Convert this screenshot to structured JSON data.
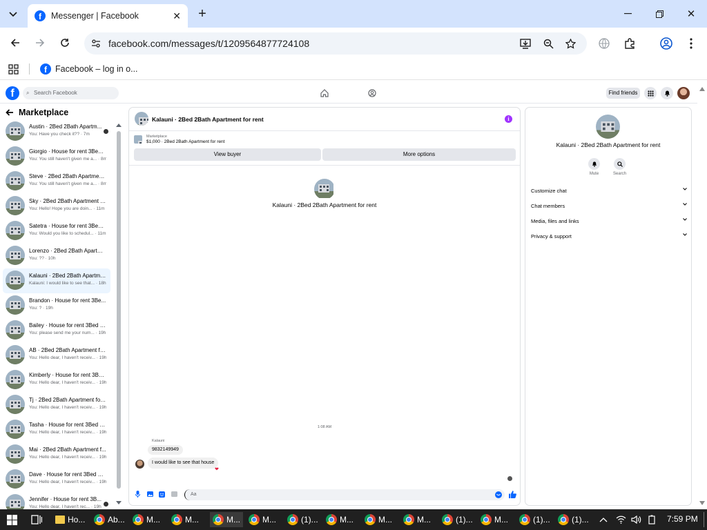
{
  "browser": {
    "tab_title": "Messenger | Facebook",
    "url": "facebook.com/messages/t/1209564877724108",
    "bookmark": "Facebook – log in o...",
    "new_tab": "+"
  },
  "fb": {
    "search_placeholder": "Search Facebook",
    "find_friends": "Find friends"
  },
  "sidebar": {
    "title": "Marketplace",
    "conversations": [
      {
        "name": "Austin · 2Bed 2Bath Apartm...",
        "snippet": "You: Have you check it?? · 7m",
        "avatar": true
      },
      {
        "name": "Giorgio · House for rent 3Bed ...",
        "snippet": "You: You still haven't given me a... · 8m"
      },
      {
        "name": "Steve · 2Bed 2Bath Apartment...",
        "snippet": "You: You still haven't given me a... · 8m"
      },
      {
        "name": "Sky · 2Bed 2Bath Apartment f...",
        "snippet": "You: Hello! Hope you are doin... · 11m"
      },
      {
        "name": "Satetra · House for rent 3Bed ...",
        "snippet": "You: Would you like to schedul... · 11m"
      },
      {
        "name": "Lorenzo · 2Bed 2Bath Apartm...",
        "snippet": "You: ?? · 10h"
      },
      {
        "name": "Kalauni · 2Bed 2Bath Apartme...",
        "snippet": "Kalauni: I would like to see that... · 18h",
        "selected": true
      },
      {
        "name": "Brandon · House for rent 3Be...",
        "snippet": "You: ? · 19h"
      },
      {
        "name": "Bailey · House for rent 3Bed 2...",
        "snippet": "You: please send me your num... · 19h"
      },
      {
        "name": "AB · 2Bed 2Bath Apartment fo...",
        "snippet": "You: Hello dear, I haven't receiv... · 19h"
      },
      {
        "name": "Kimberly · House for rent 3Be...",
        "snippet": "You: Hello dear, I haven't receiv... · 19h"
      },
      {
        "name": "Tj · 2Bed 2Bath Apartment for...",
        "snippet": "You: Hello dear, I haven't receiv... · 19h"
      },
      {
        "name": "Tasha · House for rent 3Bed 2...",
        "snippet": "You: Hello dear, I haven't receiv... · 19h"
      },
      {
        "name": "Mai · 2Bed 2Bath Apartment f...",
        "snippet": "You: Hello dear, I haven't receiv... · 19h"
      },
      {
        "name": "Dave · House for rent 3Bed 2B...",
        "snippet": "You: Hello dear, I haven't receiv... · 19h"
      },
      {
        "name": "Jennifer · House for rent 3B...",
        "snippet": "You: Hello dear, I haven't rec... · 19h",
        "avatar": true
      }
    ]
  },
  "chat": {
    "title": "Kalauni · 2Bed 2Bath Apartment for rent",
    "mp_label": "Marketplace",
    "mp_listing": "$1,000 · 2Bed 2Bath Apartment for rent",
    "view_buyer": "View buyer",
    "more_options": "More options",
    "center_title": "Kalauni · 2Bed 2Bath Apartment for rent",
    "time": "1:08 AM",
    "sender": "Kalauni",
    "msg1": "9832149949",
    "msg2": "I would like to see that house",
    "reaction": "❤",
    "composer_placeholder": "Aa"
  },
  "info": {
    "title": "Kalauni · 2Bed 2Bath Apartment for rent",
    "mute": "Mute",
    "search": "Search",
    "sections": [
      "Customize chat",
      "Chat members",
      "Media, files and links",
      "Privacy & support"
    ]
  },
  "taskbar": {
    "time": "7:59 PM",
    "apps": [
      "Ho...",
      "Ab...",
      "M...",
      "M...",
      "M...",
      "M...",
      "(1)...",
      "M...",
      "M...",
      "M...",
      "(1)...",
      "M...",
      "(1)...",
      "(1)..."
    ]
  }
}
